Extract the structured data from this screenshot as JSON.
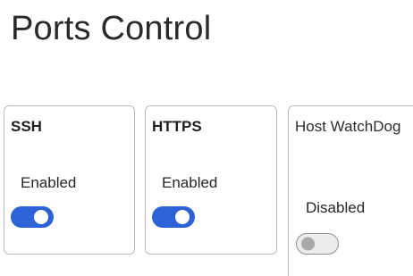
{
  "page": {
    "title": "Ports Control"
  },
  "ports": [
    {
      "name": "SSH",
      "status_label": "Enabled",
      "enabled": true
    },
    {
      "name": "HTTPS",
      "status_label": "Enabled",
      "enabled": true
    },
    {
      "name": "Host WatchDog",
      "status_label": "Disabled",
      "enabled": false
    }
  ],
  "colors": {
    "toggle_on": "#2c63d6",
    "toggle_off": "#ececec",
    "card_border": "#bdbdbd"
  }
}
